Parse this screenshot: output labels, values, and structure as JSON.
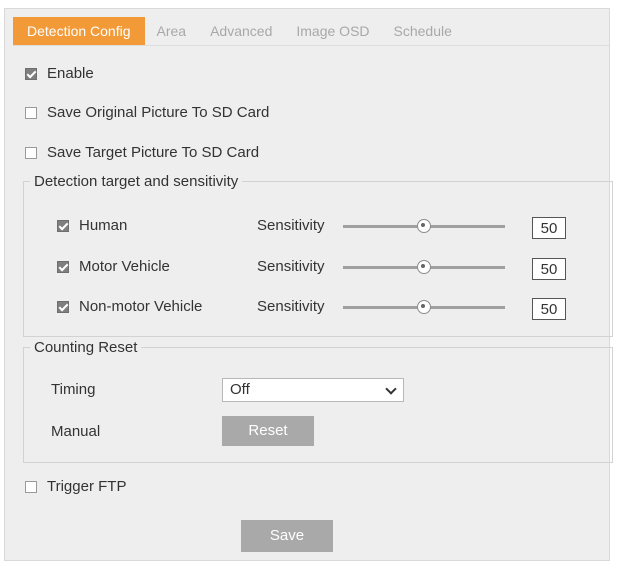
{
  "tabs": [
    {
      "label": "Detection Config",
      "active": true
    },
    {
      "label": "Area",
      "active": false
    },
    {
      "label": "Advanced",
      "active": false
    },
    {
      "label": "Image OSD",
      "active": false
    },
    {
      "label": "Schedule",
      "active": false
    }
  ],
  "enable": {
    "label": "Enable",
    "checked": true
  },
  "save_original": {
    "label": "Save Original Picture To SD Card",
    "checked": false
  },
  "save_target": {
    "label": "Save Target Picture To SD Card",
    "checked": false
  },
  "detection": {
    "legend": "Detection target and sensitivity",
    "targets": [
      {
        "label": "Human",
        "checked": true,
        "sensitivity_label": "Sensitivity",
        "value": "50",
        "level": 50
      },
      {
        "label": "Motor Vehicle",
        "checked": true,
        "sensitivity_label": "Sensitivity",
        "value": "50",
        "level": 50
      },
      {
        "label": "Non-motor Vehicle",
        "checked": true,
        "sensitivity_label": "Sensitivity",
        "value": "50",
        "level": 50
      }
    ]
  },
  "counting_reset": {
    "legend": "Counting Reset",
    "timing_label": "Timing",
    "timing_value": "Off",
    "manual_label": "Manual",
    "reset_label": "Reset"
  },
  "trigger_ftp": {
    "label": "Trigger FTP",
    "checked": false
  },
  "save_label": "Save",
  "colors": {
    "active_tab": "#f29a38",
    "button": "#a9a9a9",
    "panel": "#eeeeee"
  }
}
